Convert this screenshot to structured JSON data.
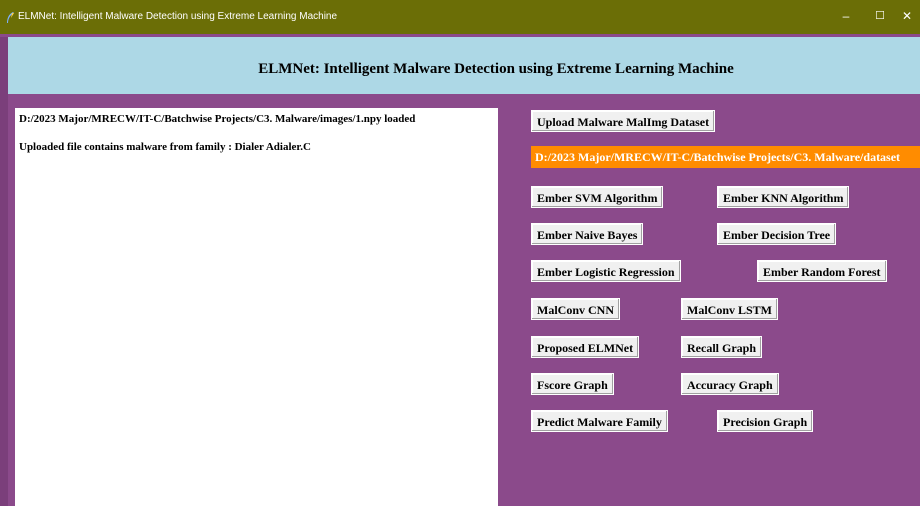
{
  "window": {
    "title": "ELMNet: Intelligent Malware Detection using Extreme Learning Machine",
    "minimize": "–",
    "maximize": "☐",
    "close": "✕"
  },
  "header": {
    "title": "ELMNet: Intelligent Malware Detection using Extreme Learning Machine"
  },
  "output": {
    "line1": "D:/2023 Major/MRECW/IT-C/Batchwise Projects/C3. Malware/images/1.npy loaded",
    "line2": "Uploaded file contains malware from family : Dialer Adialer.C"
  },
  "upload": {
    "button": "Upload Malware MalImg Dataset",
    "path": "D:/2023 Major/MRECW/IT-C/Batchwise Projects/C3. Malware/dataset"
  },
  "buttons": {
    "ember_svm": "Ember SVM Algorithm",
    "ember_knn": "Ember KNN Algorithm",
    "ember_nb": "Ember Naive Bayes",
    "ember_dt": "Ember Decision Tree",
    "ember_lr": "Ember Logistic Regression",
    "ember_rf": "Ember Random Forest",
    "malconv_cnn": "MalConv CNN",
    "malconv_lstm": "MalConv LSTM",
    "elmnet": "Proposed ELMNet",
    "recall": "Recall Graph",
    "fscore": "Fscore Graph",
    "accuracy": "Accuracy Graph",
    "predict": "Predict Malware Family",
    "precision": "Precision Graph"
  }
}
